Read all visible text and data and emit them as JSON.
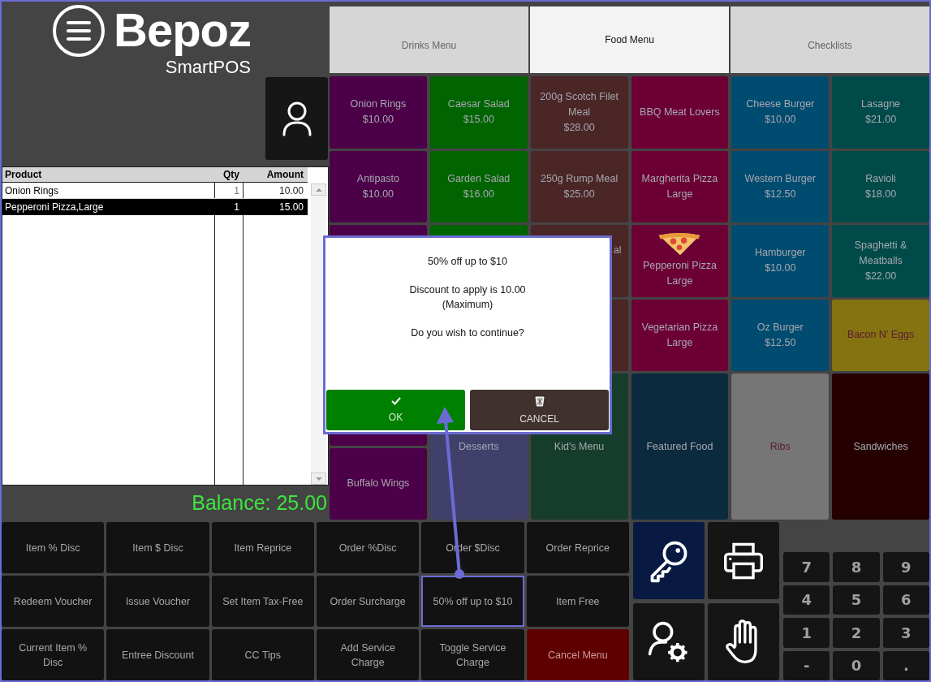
{
  "logo": {
    "name": "Bepoz",
    "tagline": "SmartPOS"
  },
  "order": {
    "columns": [
      "Product",
      "Qty",
      "Amount"
    ],
    "rows": [
      {
        "product": "Onion Rings",
        "qty": "1",
        "amount": "10.00",
        "selected": false
      },
      {
        "product": "Pepperoni Pizza,Large",
        "qty": "1",
        "amount": "15.00",
        "selected": true
      }
    ]
  },
  "balance": "Balance: 25.00",
  "tabs": [
    {
      "label": "Drinks Menu",
      "selected": false
    },
    {
      "label": "Food Menu",
      "selected": true
    },
    {
      "label": "Checklists",
      "selected": false
    }
  ],
  "tiles": [
    {
      "label": "Onion Rings",
      "price": "$10.00",
      "color": "#4b0048",
      "tall": false
    },
    {
      "label": "Caesar Salad",
      "price": "$15.00",
      "color": "#006400",
      "tall": false
    },
    {
      "label": "200g Scotch Filet Meal",
      "price": "$28.00",
      "color": "#4a2626",
      "tall": false
    },
    {
      "label": "BBQ Meat Lovers",
      "color": "#6c0034",
      "tall": false
    },
    {
      "label": "Cheese Burger",
      "price": "$10.00",
      "color": "#004b70",
      "tall": false
    },
    {
      "label": "Lasagne",
      "price": "$21.00",
      "color": "#004b4a",
      "tall": false
    },
    {
      "label": "Antipasto",
      "price": "$10.00",
      "color": "#4b0048",
      "tall": false
    },
    {
      "label": "Garden Salad",
      "price": "$16.00",
      "color": "#006400",
      "tall": false
    },
    {
      "label": "250g Rump Meal",
      "price": "$25.00",
      "color": "#4a2626",
      "tall": false
    },
    {
      "label": "Margherita Pizza Large",
      "color": "#6c0034",
      "tall": false
    },
    {
      "label": "Western Burger",
      "price": "$12.50",
      "color": "#004b70",
      "tall": false
    },
    {
      "label": "Ravioli",
      "price": "$18.00",
      "color": "#004b4a",
      "tall": false
    },
    {
      "color": "#4b0048",
      "tall": true
    },
    {
      "color": "#006400",
      "tall": true
    },
    {
      "label": "al",
      "cut": true,
      "color": "#4a2626",
      "tall": false
    },
    {
      "label": "Pepperoni Pizza Large",
      "kind": "pizza",
      "color": "#6c0034",
      "tall": false
    },
    {
      "label": "Hamburger",
      "price": "$10.00",
      "color": "#004b70",
      "tall": false
    },
    {
      "label": "Spaghetti & Meatballs",
      "price": "$22.00",
      "color": "#004b4a",
      "tall": false
    },
    {
      "color": "#4a2626",
      "tall": false
    },
    {
      "label": "Vegetarian Pizza Large",
      "color": "#6c0034",
      "tall": false
    },
    {
      "label": "Oz Burger",
      "price": "$12.50",
      "color": "#004b70",
      "tall": false
    },
    {
      "label": "Bacon N' Eggs",
      "color": "#857312",
      "tall": false
    },
    {
      "color": "#4b0048",
      "tall": false
    },
    {
      "label": "Desserts",
      "color": "#40406b",
      "tall": true
    },
    {
      "label": "Kid's Menu",
      "color": "#163d2c",
      "tall": true
    },
    {
      "label": "Featured Food",
      "color": "#0c2a3d",
      "tall": true
    },
    {
      "label": "Ribs",
      "color": "#767676",
      "tall": true
    },
    {
      "label": "Sandwiches",
      "color": "#250000",
      "tall": true
    },
    {
      "label": "Buffalo Wings",
      "color": "#4b0048",
      "tall": false
    }
  ],
  "dialog": {
    "paragraphs": [
      [
        "50% off up to $10"
      ],
      [
        "Discount to apply is 10.00",
        "(Maximum)"
      ],
      [
        "Do you wish to continue?"
      ]
    ],
    "buttons": [
      {
        "label": "OK",
        "kind": "ok"
      },
      {
        "label": "CANCEL",
        "kind": "cancel"
      }
    ]
  },
  "functions": [
    {
      "label": "Item % Disc",
      "kind": "normal",
      "highlighted": false
    },
    {
      "label": "Item $ Disc",
      "kind": "normal",
      "highlighted": false
    },
    {
      "label": "Item Reprice",
      "kind": "normal",
      "highlighted": false
    },
    {
      "label": "Order %Disc",
      "kind": "normal",
      "highlighted": false
    },
    {
      "label": "Order $Disc",
      "kind": "normal",
      "highlighted": false
    },
    {
      "label": "Order Reprice",
      "kind": "normal",
      "highlighted": false
    },
    {
      "label": "Redeem Voucher",
      "kind": "normal",
      "highlighted": false
    },
    {
      "label": "Issue Voucher",
      "kind": "normal",
      "highlighted": false
    },
    {
      "label": "Set Item Tax-Free",
      "kind": "normal",
      "highlighted": false
    },
    {
      "label": "Order Surcharge",
      "kind": "normal",
      "highlighted": false
    },
    {
      "label": "50% off up to $10",
      "kind": "normal",
      "highlighted": true
    },
    {
      "label": "Item Free",
      "kind": "normal",
      "highlighted": false
    },
    {
      "label": "Current Item % Disc",
      "kind": "normal",
      "highlighted": false
    },
    {
      "label": "Entree Discount",
      "kind": "normal",
      "highlighted": false
    },
    {
      "label": "CC Tips",
      "kind": "normal",
      "highlighted": false
    },
    {
      "label": "Add Service Charge",
      "kind": "normal",
      "highlighted": false
    },
    {
      "label": "Toggle Service Charge",
      "kind": "normal",
      "highlighted": false
    },
    {
      "label": "Cancel Menu",
      "kind": "danger",
      "highlighted": false
    }
  ],
  "tools": [
    {
      "kind": "key",
      "active": true
    },
    {
      "kind": "printer",
      "active": false
    },
    {
      "kind": "user-settings",
      "active": false
    },
    {
      "kind": "hand",
      "active": false
    }
  ],
  "keypad": [
    "7",
    "8",
    "9",
    "4",
    "5",
    "6",
    "1",
    "2",
    "3",
    "-",
    "0",
    "."
  ]
}
